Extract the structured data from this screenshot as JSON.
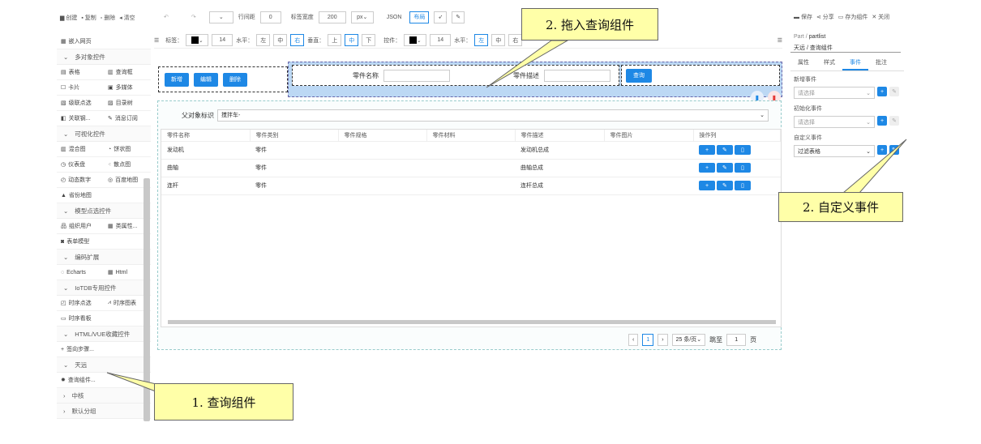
{
  "toolbar": {
    "create": "创建",
    "copy": "复制",
    "delete": "删除",
    "clear": "清空",
    "row_gap_label": "行间距",
    "row_gap_value": "0",
    "label_width_label": "标签宽度",
    "label_width_value": "200",
    "unit": "px",
    "json": "JSON",
    "layout": "布局"
  },
  "toolbar2": {
    "label": "标签：",
    "font_size": "14",
    "halign_label": "水平：",
    "left": "左",
    "center": "中",
    "right": "右",
    "valign_label": "垂直：",
    "top": "上",
    "middle": "中",
    "bottom": "下",
    "control_label": "控件：",
    "font_size2": "14",
    "halign2_label": "水平：",
    "left2": "左",
    "center2": "中",
    "right2": "右"
  },
  "left_panel": {
    "embed": "嵌入网页",
    "group_multi": "多对象控件",
    "multi_items": [
      "表格",
      "查询框",
      "卡片",
      "多媒体",
      "级联点选",
      "目录树",
      "关联钢...",
      "消息订阅"
    ],
    "group_vis": "可视化控件",
    "vis_items": [
      "混合图",
      "饼状图",
      "仪表盘",
      "散点图",
      "动态数字",
      "百度地图",
      "省份地图"
    ],
    "group_model": "模型点选控件",
    "model_items": [
      "组织用户",
      "类属性...",
      "表单模型"
    ],
    "group_ext": "编码扩展",
    "ext_items": [
      "Echarts",
      "Html"
    ],
    "group_iotdb": "IoTDB专用控件",
    "iotdb_items": [
      "时序点选",
      "时序图表",
      "时序看板"
    ],
    "group_html": "HTML/VUE收藏控件",
    "html_items": [
      "签向步骤..."
    ],
    "group_tianyuan": "天远",
    "tianyuan_items": [
      "查询组件..."
    ],
    "group_zhonghe": "中核",
    "group_default": "默认分组"
  },
  "canvas": {
    "add": "新增",
    "edit": "编辑",
    "del": "删除",
    "part_name": "零件名称",
    "part_desc": "零件描述",
    "query": "查询",
    "parent_label": "父对象标识",
    "parent_value": "搅拌车-",
    "columns": [
      "零件名称",
      "零件类别",
      "零件规格",
      "零件材料",
      "零件描述",
      "零件图片",
      "操作列"
    ],
    "rows": [
      [
        "发动机",
        "零件",
        "",
        "",
        "发动机总成",
        ""
      ],
      [
        "曲轴",
        "零件",
        "",
        "",
        "曲轴总成",
        ""
      ],
      [
        "连杆",
        "零件",
        "",
        "",
        "连杆总成",
        ""
      ]
    ],
    "page_current": "1",
    "page_size": "25 条/页",
    "goto_label": "跳至",
    "goto_value": "1",
    "page_suffix": "页"
  },
  "right_panel": {
    "save": "保存",
    "share": "分享",
    "save_as": "存为组件",
    "close": "关闭",
    "crumb1": "Part",
    "crumb2": "partlist",
    "component": "天远 / 查询组件",
    "tabs": [
      "属性",
      "样式",
      "事件",
      "批注"
    ],
    "active_tab": "事件",
    "new_event": "新增事件",
    "init_event": "初始化事件",
    "custom_event": "自定义事件",
    "placeholder": "请选择",
    "custom_value": "过滤表格"
  },
  "callouts": {
    "c1": "1. 查询组件",
    "c2": "2. 拖入查询组件",
    "c3": "2. 自定义事件"
  }
}
